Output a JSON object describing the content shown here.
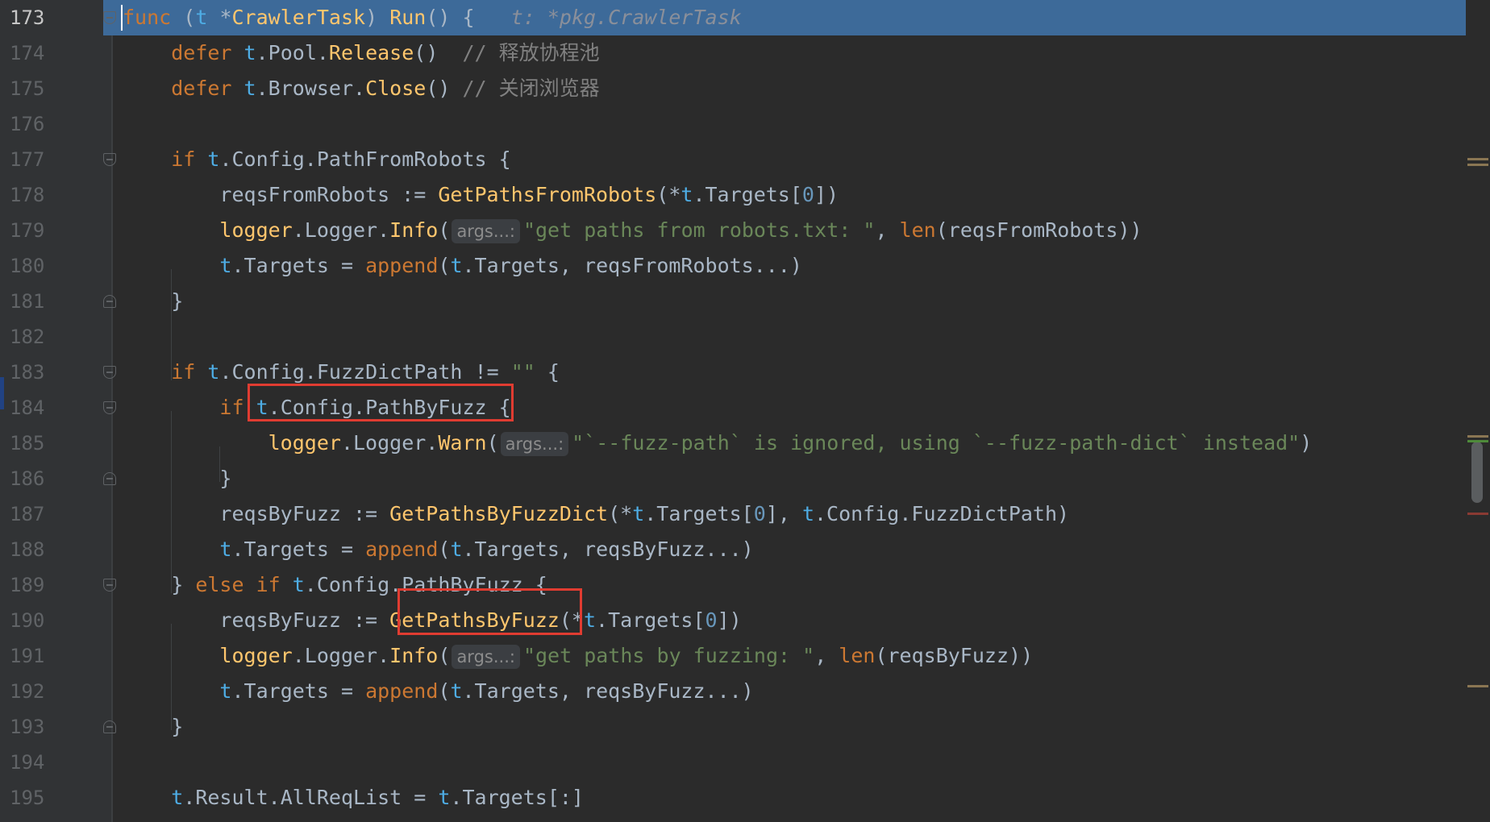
{
  "editor": {
    "current_line": "173",
    "lines": [
      {
        "num": "173",
        "tokens": [
          {
            "t": "func",
            "c": "kw"
          },
          {
            "t": " ("
          },
          {
            "t": "t",
            "c": "recv"
          },
          {
            "t": " *"
          },
          {
            "t": "CrawlerTask",
            "c": "fn"
          },
          {
            "t": ") "
          },
          {
            "t": "Run",
            "c": "fn"
          },
          {
            "t": "() {   "
          },
          {
            "t": "t: *pkg.CrawlerTask",
            "c": "hint-italic"
          }
        ]
      },
      {
        "num": "174",
        "tokens": [
          {
            "t": "    "
          },
          {
            "t": "defer",
            "c": "kw"
          },
          {
            "t": " "
          },
          {
            "t": "t",
            "c": "recv"
          },
          {
            "t": ".Pool."
          },
          {
            "t": "Release",
            "c": "fn"
          },
          {
            "t": "()  "
          },
          {
            "t": "// ",
            "c": "cm"
          },
          {
            "t": "释放协程池",
            "c": "cm cm-cn"
          }
        ]
      },
      {
        "num": "175",
        "tokens": [
          {
            "t": "    "
          },
          {
            "t": "defer",
            "c": "kw"
          },
          {
            "t": " "
          },
          {
            "t": "t",
            "c": "recv"
          },
          {
            "t": ".Browser."
          },
          {
            "t": "Close",
            "c": "fn"
          },
          {
            "t": "() "
          },
          {
            "t": "// ",
            "c": "cm"
          },
          {
            "t": "关闭浏览器",
            "c": "cm cm-cn"
          }
        ]
      },
      {
        "num": "176",
        "tokens": []
      },
      {
        "num": "177",
        "tokens": [
          {
            "t": "    "
          },
          {
            "t": "if",
            "c": "kw"
          },
          {
            "t": " "
          },
          {
            "t": "t",
            "c": "recv"
          },
          {
            "t": ".Config.PathFromRobots {"
          }
        ]
      },
      {
        "num": "178",
        "tokens": [
          {
            "t": "        reqsFromRobots := "
          },
          {
            "t": "GetPathsFromRobots",
            "c": "fn"
          },
          {
            "t": "(*"
          },
          {
            "t": "t",
            "c": "recv"
          },
          {
            "t": ".Targets["
          },
          {
            "t": "0",
            "c": "num"
          },
          {
            "t": "])"
          }
        ]
      },
      {
        "num": "179",
        "tokens": [
          {
            "t": "        "
          },
          {
            "t": "logger",
            "c": "fn"
          },
          {
            "t": ".Logger."
          },
          {
            "t": "Info",
            "c": "fn"
          },
          {
            "t": "("
          },
          {
            "t": "args...:",
            "c": "param-hint"
          },
          {
            "t": "\"get paths from robots.txt: \"",
            "c": "str"
          },
          {
            "t": ", "
          },
          {
            "t": "len",
            "c": "bi"
          },
          {
            "t": "(reqsFromRobots))"
          }
        ]
      },
      {
        "num": "180",
        "tokens": [
          {
            "t": "        "
          },
          {
            "t": "t",
            "c": "recv"
          },
          {
            "t": ".Targets = "
          },
          {
            "t": "append",
            "c": "bi"
          },
          {
            "t": "("
          },
          {
            "t": "t",
            "c": "recv"
          },
          {
            "t": ".Targets, reqsFromRobots...)"
          }
        ]
      },
      {
        "num": "181",
        "tokens": [
          {
            "t": "    }"
          }
        ]
      },
      {
        "num": "182",
        "tokens": []
      },
      {
        "num": "183",
        "tokens": [
          {
            "t": "    "
          },
          {
            "t": "if",
            "c": "kw"
          },
          {
            "t": " "
          },
          {
            "t": "t",
            "c": "recv"
          },
          {
            "t": ".Config.FuzzDictPath != "
          },
          {
            "t": "\"\"",
            "c": "str"
          },
          {
            "t": " {"
          }
        ]
      },
      {
        "num": "184",
        "tokens": [
          {
            "t": "        "
          },
          {
            "t": "if",
            "c": "kw"
          },
          {
            "t": " "
          },
          {
            "t": "t",
            "c": "recv"
          },
          {
            "t": ".Config.PathByFuzz {"
          }
        ]
      },
      {
        "num": "185",
        "tokens": [
          {
            "t": "            "
          },
          {
            "t": "logger",
            "c": "fn"
          },
          {
            "t": ".Logger."
          },
          {
            "t": "Warn",
            "c": "fn"
          },
          {
            "t": "("
          },
          {
            "t": "args...:",
            "c": "param-hint"
          },
          {
            "t": "\"`--fuzz-path` is ignored, using `--fuzz-path-dict` instead\"",
            "c": "str"
          },
          {
            "t": ")"
          }
        ]
      },
      {
        "num": "186",
        "tokens": [
          {
            "t": "        }"
          }
        ]
      },
      {
        "num": "187",
        "tokens": [
          {
            "t": "        reqsByFuzz := "
          },
          {
            "t": "GetPathsByFuzzDict",
            "c": "fn"
          },
          {
            "t": "(*"
          },
          {
            "t": "t",
            "c": "recv"
          },
          {
            "t": ".Targets["
          },
          {
            "t": "0",
            "c": "num"
          },
          {
            "t": "], "
          },
          {
            "t": "t",
            "c": "recv"
          },
          {
            "t": ".Config.FuzzDictPath)"
          }
        ]
      },
      {
        "num": "188",
        "tokens": [
          {
            "t": "        "
          },
          {
            "t": "t",
            "c": "recv"
          },
          {
            "t": ".Targets = "
          },
          {
            "t": "append",
            "c": "bi"
          },
          {
            "t": "("
          },
          {
            "t": "t",
            "c": "recv"
          },
          {
            "t": ".Targets, reqsByFuzz...)"
          }
        ]
      },
      {
        "num": "189",
        "tokens": [
          {
            "t": "    } "
          },
          {
            "t": "else if",
            "c": "kw"
          },
          {
            "t": " "
          },
          {
            "t": "t",
            "c": "recv"
          },
          {
            "t": ".Config.PathByFuzz {"
          }
        ]
      },
      {
        "num": "190",
        "tokens": [
          {
            "t": "        reqsByFuzz := "
          },
          {
            "t": "GetPathsByFuzz",
            "c": "fn"
          },
          {
            "t": "(*"
          },
          {
            "t": "t",
            "c": "recv"
          },
          {
            "t": ".Targets["
          },
          {
            "t": "0",
            "c": "num"
          },
          {
            "t": "])"
          }
        ]
      },
      {
        "num": "191",
        "tokens": [
          {
            "t": "        "
          },
          {
            "t": "logger",
            "c": "fn"
          },
          {
            "t": ".Logger."
          },
          {
            "t": "Info",
            "c": "fn"
          },
          {
            "t": "("
          },
          {
            "t": "args...:",
            "c": "param-hint"
          },
          {
            "t": "\"get paths by fuzzing: \"",
            "c": "str"
          },
          {
            "t": ", "
          },
          {
            "t": "len",
            "c": "bi"
          },
          {
            "t": "(reqsByFuzz))"
          }
        ]
      },
      {
        "num": "192",
        "tokens": [
          {
            "t": "        "
          },
          {
            "t": "t",
            "c": "recv"
          },
          {
            "t": ".Targets = "
          },
          {
            "t": "append",
            "c": "bi"
          },
          {
            "t": "("
          },
          {
            "t": "t",
            "c": "recv"
          },
          {
            "t": ".Targets, reqsByFuzz...)"
          }
        ]
      },
      {
        "num": "193",
        "tokens": [
          {
            "t": "    }"
          }
        ]
      },
      {
        "num": "194",
        "tokens": []
      },
      {
        "num": "195",
        "tokens": [
          {
            "t": "    "
          },
          {
            "t": "t",
            "c": "recv"
          },
          {
            "t": ".Result.AllReqList = "
          },
          {
            "t": "t",
            "c": "recv"
          },
          {
            "t": ".Targets[:]"
          }
        ]
      }
    ]
  },
  "colors": {
    "background": "#2b2b2b",
    "gutter": "#313335",
    "current_line_highlight": "#3d6a99",
    "annotation_box": "#e03c31"
  }
}
